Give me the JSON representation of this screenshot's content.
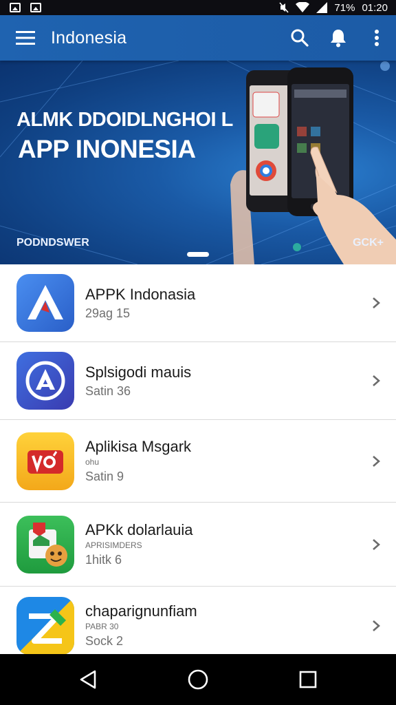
{
  "status_bar": {
    "battery_text": "71%",
    "time": "01:20"
  },
  "app_bar": {
    "title": "Indonesia",
    "icons": [
      "menu-icon",
      "search-icon",
      "bell-icon",
      "more-vert-icon"
    ]
  },
  "banner": {
    "title_line1": "ALMK DDOIDLNGHOI L",
    "title_line2": "APP INONESIA",
    "footer_left": "PODNDSWER",
    "footer_right": "GCK+"
  },
  "apps": [
    {
      "name": "APPK Indonasia",
      "sub": "",
      "meta": "29ag 15",
      "icon": "red-a-icon"
    },
    {
      "name": "Splsigodi mauis",
      "sub": "",
      "meta": "Satin 36",
      "icon": "circle-a-icon"
    },
    {
      "name": "Aplikisa Msgark",
      "sub": "ohu",
      "meta": "Satin 9",
      "icon": "vo-icon"
    },
    {
      "name": "APKk dolarlauia",
      "sub": "APRISIMDERS",
      "meta": "1hitk 6",
      "icon": "green-mascot-icon"
    },
    {
      "name": "chaparignunfiam",
      "sub": "PABR 30",
      "meta": "Sock 2",
      "icon": "colorful-z-icon"
    }
  ],
  "nav": {
    "icons": [
      "back-icon",
      "home-icon",
      "recents-icon"
    ]
  },
  "colors": {
    "primary": "#1f63b0",
    "banner_dark": "#0f3f80",
    "text_primary": "#1b1b1b",
    "text_secondary": "#6f6f6f"
  }
}
